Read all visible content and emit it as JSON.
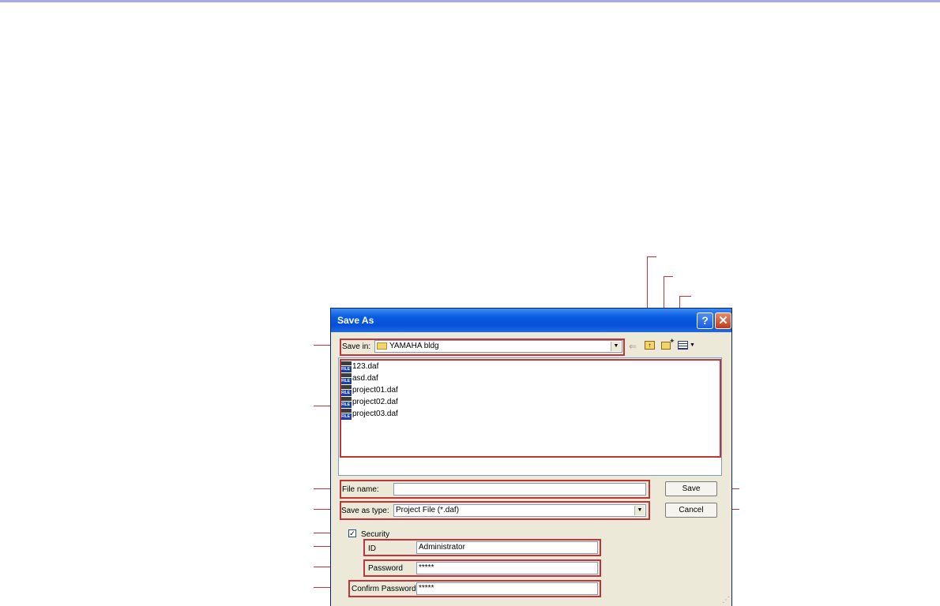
{
  "window": {
    "title": "Save As",
    "help_label": "?",
    "close_label": "✕"
  },
  "toolbar": {
    "save_in_label": "Save in:",
    "location": "YAMAHA bldg",
    "back_icon": "back-arrow-icon",
    "up_icon": "up-folder-icon",
    "new_folder_icon": "new-folder-icon",
    "view_menu_icon": "view-menu-icon"
  },
  "files": [
    {
      "name": "123.daf"
    },
    {
      "name": "asd.daf"
    },
    {
      "name": "project01.daf"
    },
    {
      "name": "project02.daf"
    },
    {
      "name": "project03.daf"
    }
  ],
  "file_icon_text": "FILE",
  "form": {
    "file_name_label": "File name:",
    "file_name_value": "",
    "save_type_label": "Save as type:",
    "save_type_value": "Project File (*.daf)",
    "security_label": "Security",
    "security_checked": true,
    "id_label": "ID",
    "id_value": "Administrator",
    "password_label": "Password",
    "password_value": "*****",
    "confirm_label": "Confirm Password",
    "confirm_value": "*****"
  },
  "buttons": {
    "save": "Save",
    "cancel": "Cancel"
  },
  "colors": {
    "accent": "#0a5de0",
    "callout": "#c0353a",
    "dialog_bg": "#ece9d8"
  }
}
